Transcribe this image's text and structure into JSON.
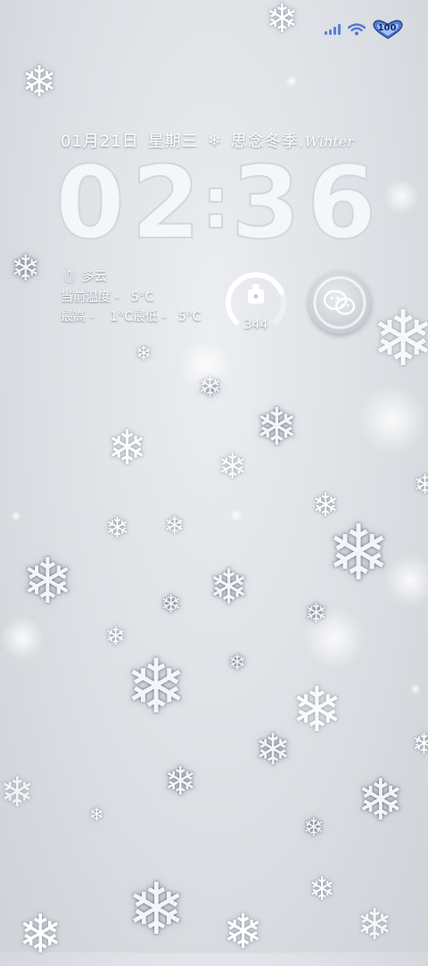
{
  "status_bar": {
    "signal_icon": "cellular-signal-icon",
    "wifi_icon": "wifi-icon",
    "battery_icon": "heart-battery-icon",
    "battery_level": "100",
    "accent_color": "#4f78d8"
  },
  "lockscreen": {
    "date": "01月21日",
    "weekday": "星期三",
    "snow_icon": "snowflake-icon",
    "theme_text": "思念冬季.",
    "theme_script": "Winter",
    "clock": {
      "h1": "0",
      "h2": "2",
      "colon": ":",
      "m1": "3",
      "m2": "6"
    }
  },
  "weather": {
    "icon": "snowman-icon",
    "condition": "多云",
    "current_temp_line": "当前温度 -   5°C",
    "range_line": "最高 -    1°C最低 -   5°C"
  },
  "widgets": {
    "steps_icon": "step-counter-ring-icon",
    "steps_value": "344",
    "steps_progress": 0.75,
    "wechat_icon": "wechat-icon"
  }
}
